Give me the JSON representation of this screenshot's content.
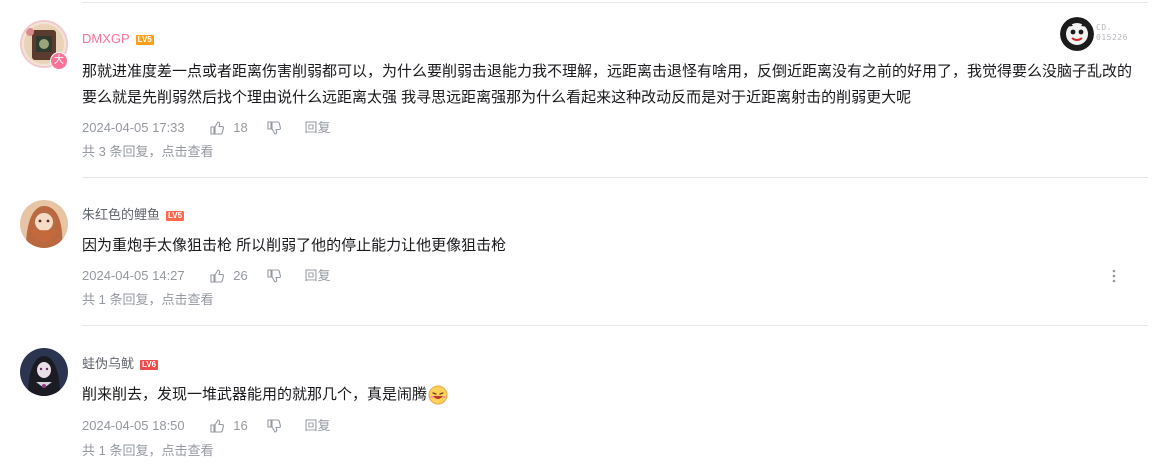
{
  "comments": [
    {
      "username": "DMXGP",
      "username_color": "#fb7299",
      "level": "LV5",
      "level_color": "#ff9f1a",
      "avatar_badge": "大",
      "content": "那就进准度差一点或者距离伤害削弱都可以，为什么要削弱击退能力我不理解，远距离击退怪有啥用，反倒近距离没有之前的好用了，我觉得要么没脑子乱改的要么就是先削弱然后找个理由说什么远距离太强 我寻思远距离强那为什么看起来这种改动反而是对于近距离射击的削弱更大呢",
      "date": "2024-04-05 17:33",
      "likes": "18",
      "reply_label": "回复",
      "replies_text": "共 3 条回复，",
      "view_text": "点击查看"
    },
    {
      "username": "朱红色的鲤鱼",
      "username_color": "#61666d",
      "level": "LV5",
      "level_color": "#ff6a4d",
      "content": "因为重炮手太像狙击枪 所以削弱了他的停止能力让他更像狙击枪",
      "date": "2024-04-05 14:27",
      "likes": "26",
      "reply_label": "回复",
      "replies_text": "共 1 条回复，",
      "view_text": "点击查看"
    },
    {
      "username": "蛙伪乌鱿",
      "username_color": "#61666d",
      "level": "LV6",
      "level_color": "#f04c49",
      "content": "削来削去，发现一堆武器能用的就那几个，真是闹腾",
      "date": "2024-04-05 18:50",
      "likes": "16",
      "reply_label": "回复",
      "replies_text": "共 1 条回复，",
      "view_text": "点击查看"
    }
  ],
  "medal": {
    "line1": "CD.",
    "line2": "015226"
  },
  "icons": {
    "like": "thumbs-up-icon",
    "dislike": "thumbs-down-icon",
    "more": "more-vertical-icon",
    "emoji": "laughing-emoji-icon"
  }
}
